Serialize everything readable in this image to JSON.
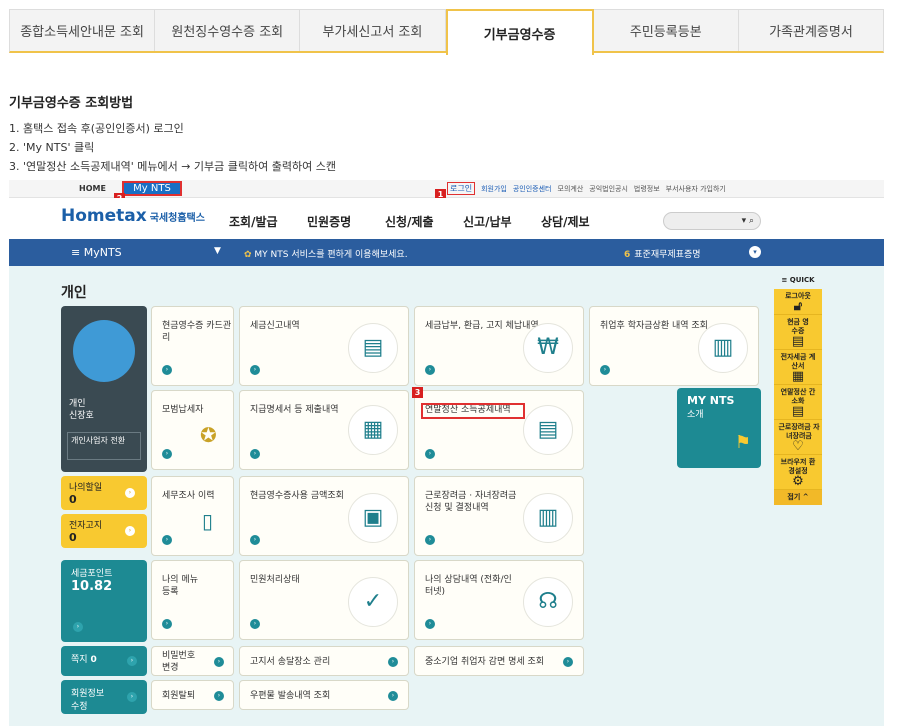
{
  "tabs": [
    "종합소득세안내문 조회",
    "원천징수영수증 조회",
    "부가세신고서 조회",
    "기부금영수증",
    "주민등록등본",
    "가족관계증명서"
  ],
  "active_tab": "기부금영수증",
  "guide": {
    "title": "기부금영수증 조회방법",
    "steps": [
      "1. 홈택스 접속 후(공인인증서) 로그인",
      "2. 'My NTS' 클릭",
      "3. '연말정산 소득공제내역' 메뉴에서 → 기부금 클릭하여 출력하여 스캔"
    ]
  },
  "hometax": {
    "topbar": {
      "home": "HOME",
      "mynts": "My NTS",
      "login": "로그인",
      "links": [
        "회원가입",
        "공인인증센터",
        "모의계산",
        "공익법인공시",
        "법령정보",
        "부서사용자 가입하기"
      ]
    },
    "logo": "Hometax",
    "logo_sub": "국세청홈택스",
    "nav": [
      "조회/발급",
      "민원증명",
      "신청/제출",
      "신고/납부",
      "상담/제보"
    ],
    "menu_label": "≡  MyNTS",
    "message": "MY NTS 서비스를 편하게 이용해보세요.",
    "std_num": "6",
    "std_label": "표준재무제표증명",
    "section": "개인",
    "profile": {
      "name1": "개인",
      "name2": "신장호",
      "button": "개인사업자 전환"
    },
    "cards": [
      "현금영수증 카드관리",
      "세금신고내역",
      "세금납부, 환급, 고지 체납내역",
      "취업후 학자금상환 내역 조회",
      "모범납세자",
      "지급명세서 등 제출내역",
      "연말정산 소득공제내역",
      "세무조사 이력",
      "현금영수증사용 금액조회",
      "근로장려금 · 자녀장려금 신청 및 결정내역",
      "나의 메뉴 등록",
      "민원처리상태",
      "나의 상담내역 (전화/인터넷)",
      "비밀번호 변경",
      "고지서 송달장소 관리",
      "중소기업 취업자 감면 명세 조회",
      "회원탈퇴",
      "우편물 발송내역 조회"
    ],
    "left": {
      "todo": "나의할일",
      "todo_n": "0",
      "notice": "전자고지",
      "notice_n": "0",
      "points": "세금포인트",
      "points_v": "10.82",
      "note": "쪽지",
      "note_n": "0",
      "member": "회원정보 수정"
    },
    "mynts_card": {
      "title": "MY NTS",
      "sub": "소개"
    },
    "quick": {
      "title": "≡ QUICK",
      "items": [
        "로그아웃",
        "현금 영수증",
        "전자세금 계산서",
        "연말정산 간소화",
        "근로장려금 자녀장려금",
        "브라우저 환경설정",
        "접기 ^"
      ]
    },
    "badges": [
      "1",
      "2",
      "3"
    ]
  }
}
